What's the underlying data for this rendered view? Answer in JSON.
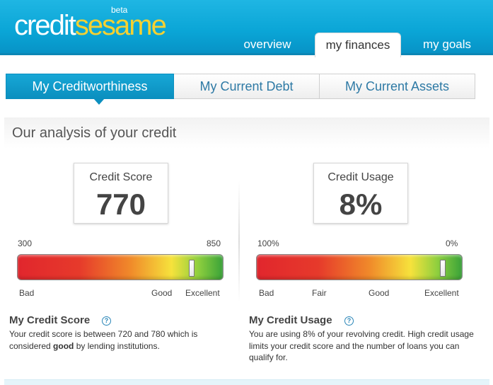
{
  "header": {
    "logo": {
      "word1": "credit",
      "word2": "sesame",
      "badge": "beta"
    },
    "nav": [
      "overview",
      "my finances",
      "my goals"
    ],
    "active_nav": "my finances"
  },
  "subtabs": [
    "My Creditworthiness",
    "My Current Debt",
    "My Current Assets"
  ],
  "active_subtab": "My Creditworthiness",
  "analysis": {
    "title": "Our analysis of your credit",
    "credit_score": {
      "label": "Credit Score",
      "value": "770",
      "range_min": "300",
      "range_max": "850",
      "marker_fraction": 0.85,
      "bands": [
        "Bad",
        "Good",
        "Excellent"
      ],
      "desc_title": "My Credit Score",
      "desc_prefix": "Your credit score is between 720 and 780 which is considered ",
      "desc_emphasis": "good",
      "desc_suffix": " by lending institutions."
    },
    "credit_usage": {
      "label": "Credit Usage",
      "value": "8%",
      "range_min": "100%",
      "range_max": "0%",
      "marker_fraction": 0.91,
      "bands": [
        "Bad",
        "Fair",
        "Good",
        "Excellent"
      ],
      "desc_title": "My Credit Usage",
      "desc_text": "You are using 8% of your revolving credit. High credit usage limits your credit score and the number of loans you can qualify for."
    }
  },
  "colors": {
    "header_blue": "#0aa5d6",
    "logo_yellow": "#f5d132",
    "link_blue": "#2e7aa5"
  },
  "icons": {
    "help": "question-circle-icon"
  }
}
